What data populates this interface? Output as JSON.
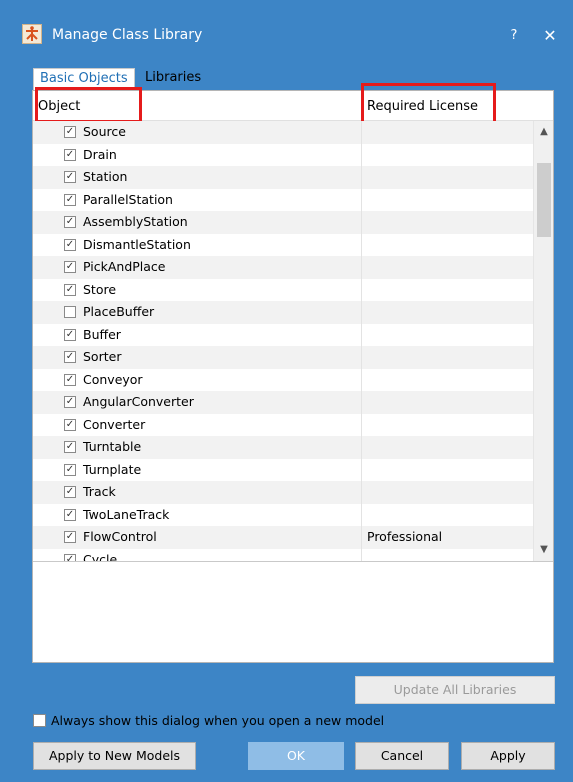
{
  "window": {
    "title": "Manage Class Library",
    "help_label": "?",
    "close_label": "✕"
  },
  "tabs": [
    {
      "label": "Basic Objects",
      "active": true
    },
    {
      "label": "Libraries",
      "active": false
    }
  ],
  "list": {
    "columns": [
      "Object",
      "Required License"
    ],
    "rows": [
      {
        "name": "Source",
        "checked": true,
        "license": ""
      },
      {
        "name": "Drain",
        "checked": true,
        "license": ""
      },
      {
        "name": "Station",
        "checked": true,
        "license": ""
      },
      {
        "name": "ParallelStation",
        "checked": true,
        "license": ""
      },
      {
        "name": "AssemblyStation",
        "checked": true,
        "license": ""
      },
      {
        "name": "DismantleStation",
        "checked": true,
        "license": ""
      },
      {
        "name": "PickAndPlace",
        "checked": true,
        "license": ""
      },
      {
        "name": "Store",
        "checked": true,
        "license": ""
      },
      {
        "name": "PlaceBuffer",
        "checked": false,
        "license": ""
      },
      {
        "name": "Buffer",
        "checked": true,
        "license": ""
      },
      {
        "name": "Sorter",
        "checked": true,
        "license": ""
      },
      {
        "name": "Conveyor",
        "checked": true,
        "license": ""
      },
      {
        "name": "AngularConverter",
        "checked": true,
        "license": ""
      },
      {
        "name": "Converter",
        "checked": true,
        "license": ""
      },
      {
        "name": "Turntable",
        "checked": true,
        "license": ""
      },
      {
        "name": "Turnplate",
        "checked": true,
        "license": ""
      },
      {
        "name": "Track",
        "checked": true,
        "license": ""
      },
      {
        "name": "TwoLaneTrack",
        "checked": true,
        "license": ""
      },
      {
        "name": "FlowControl",
        "checked": true,
        "license": "Professional"
      },
      {
        "name": "Cycle",
        "checked": true,
        "license": ""
      }
    ]
  },
  "buttons": {
    "update_all": "Update All Libraries",
    "apply_new": "Apply to New Models",
    "ok": "OK",
    "cancel": "Cancel",
    "apply": "Apply"
  },
  "always_show": {
    "label": "Always show this dialog when you open a new model",
    "checked": false
  },
  "colors": {
    "titlebar": "#3d85c6",
    "highlight": "#e51b1b",
    "tab_active_text": "#1f6fb5"
  }
}
